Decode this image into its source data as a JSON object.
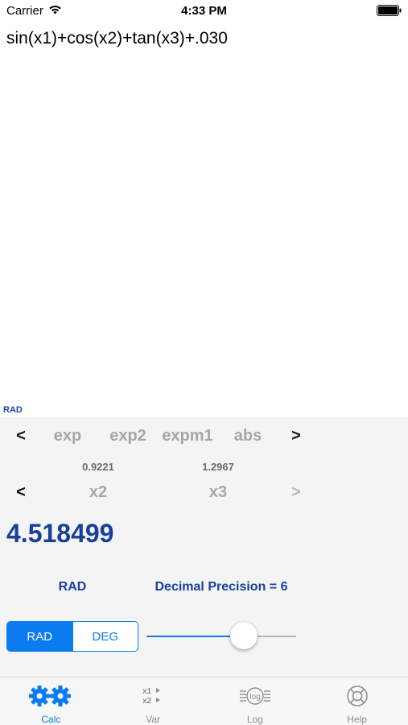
{
  "status_bar": {
    "carrier": "Carrier",
    "time": "4:33 PM"
  },
  "expression": "sin(x1)+cos(x2)+tan(x3)+.030",
  "mode_indicator": "RAD",
  "function_row": {
    "prev": "<",
    "items": [
      "exp",
      "exp2",
      "expm1",
      "abs"
    ],
    "next": ">"
  },
  "variable_values": {
    "x2": "0.9221",
    "x3": "1.2967"
  },
  "variable_row": {
    "prev": "<",
    "items": [
      "x2",
      "x3"
    ],
    "next": ">"
  },
  "result": "4.518499",
  "info": {
    "angle_mode": "RAD",
    "precision": "Decimal Precision = 6"
  },
  "angle_toggle": {
    "options": [
      "RAD",
      "DEG"
    ],
    "selected": "RAD"
  },
  "precision_slider": {
    "fraction": 0.65
  },
  "tabs": [
    {
      "label": "Calc",
      "icon": "gears-icon",
      "active": true
    },
    {
      "label": "Var",
      "icon": "variables-icon",
      "active": false
    },
    {
      "label": "Log",
      "icon": "log-icon",
      "active": false
    },
    {
      "label": "Help",
      "icon": "lifebuoy-icon",
      "active": false
    }
  ],
  "colors": {
    "accent": "#0a7cf0",
    "result_blue": "#17409a",
    "inactive_gray": "#a6a6a6"
  }
}
